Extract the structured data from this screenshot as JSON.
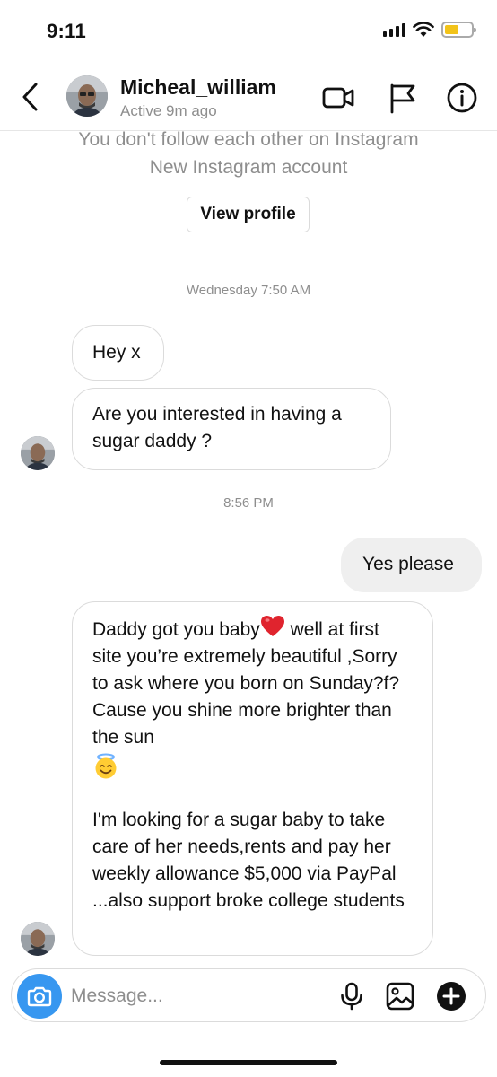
{
  "status_bar": {
    "time": "9:11",
    "battery_level": 0.55,
    "battery_color": "#f2c319"
  },
  "header": {
    "username": "Micheal_william",
    "activity": "Active 9m ago",
    "icons": [
      "back-chevron-icon",
      "video-call-icon",
      "report-flag-icon",
      "info-icon"
    ]
  },
  "profile_notice": {
    "line1": "You don't follow each other on Instagram",
    "line2": "New Instagram account",
    "view_profile_label": "View profile"
  },
  "thread": {
    "timestamp1": "Wednesday 7:50 AM",
    "msg1": "Hey x",
    "msg2": "Are you interested in having a sugar daddy ?",
    "timestamp2": "8:56 PM",
    "reply1": "Yes please",
    "msg3_part1": "Daddy got you baby",
    "msg3_emoji1": "red-heart",
    "msg3_part2": " well at first site you’re extremely beautiful ,Sorry to ask where you born on Sunday?f? Cause you shine more brighter than the sun",
    "msg3_emoji2": "smiling-face-with-halo",
    "msg3_paragraph2": "I'm looking for a sugar baby to take care of her needs,rents and pay her weekly allowance $5,000 via PayPal ...also support broke college students"
  },
  "composer": {
    "placeholder": "Message...",
    "camera_color": "#3797f0",
    "icons": [
      "camera-icon",
      "microphone-icon",
      "gallery-icon",
      "add-icon"
    ]
  }
}
